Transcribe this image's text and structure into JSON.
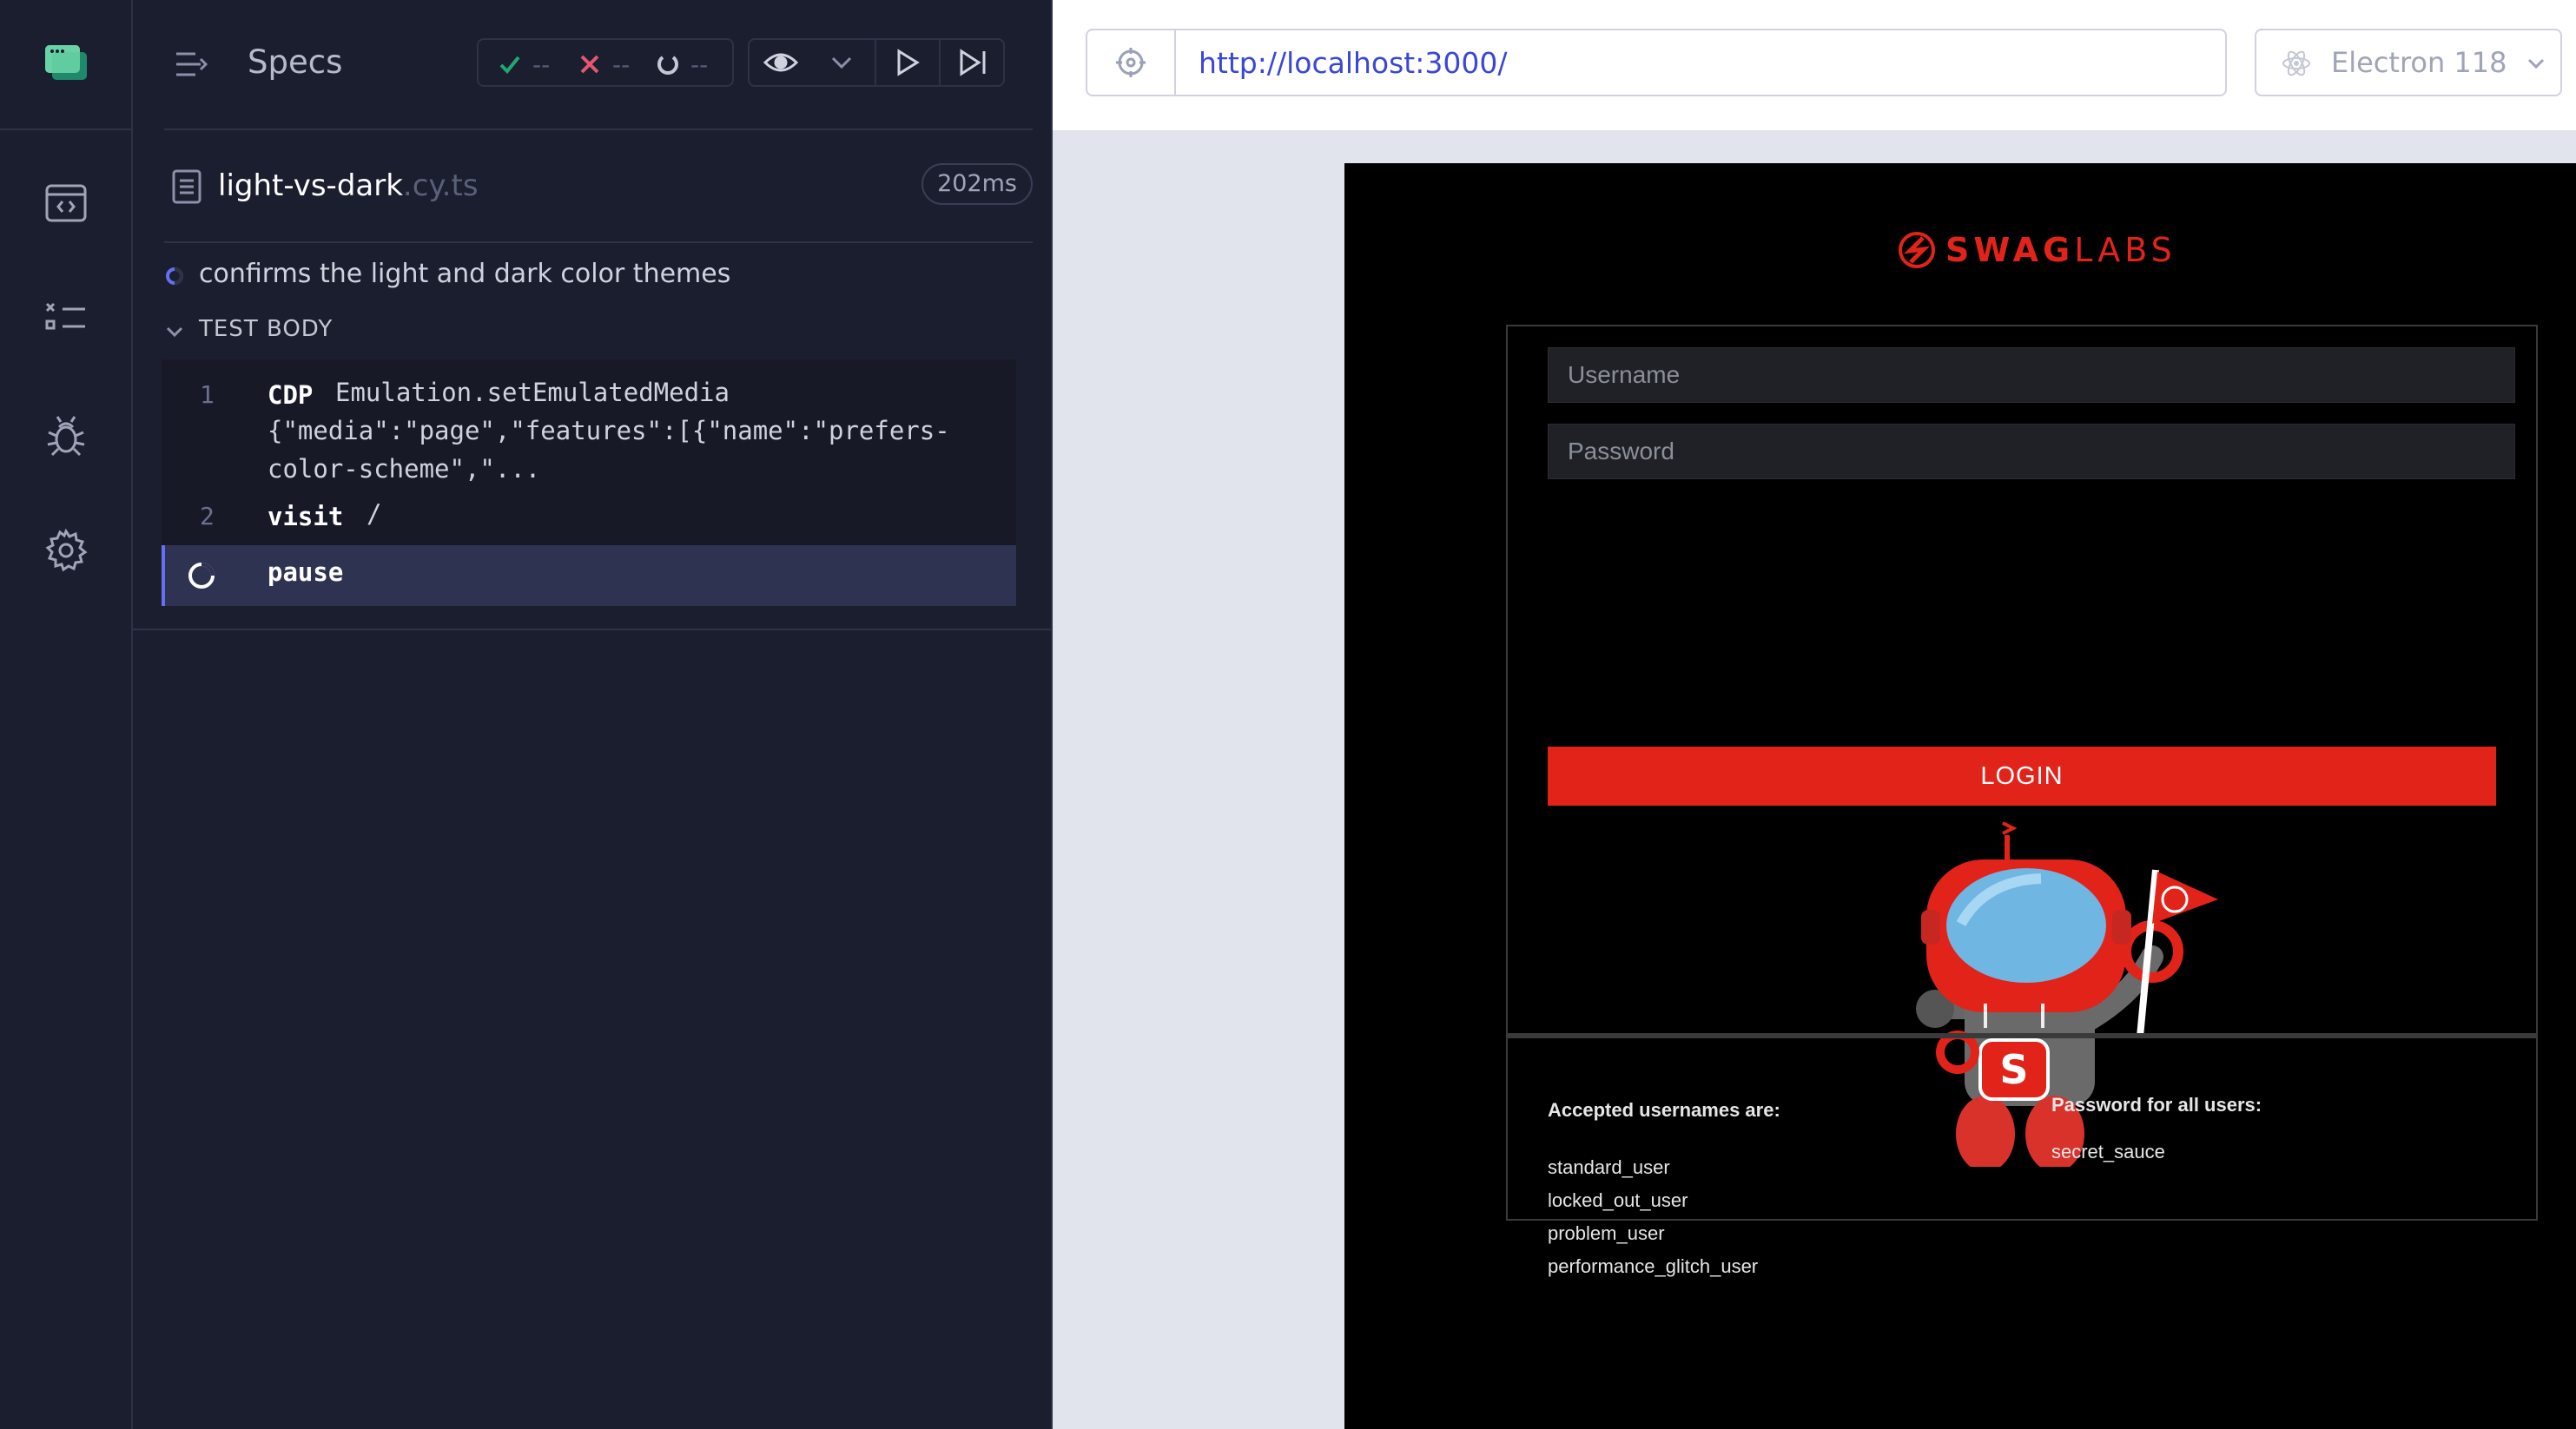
{
  "sidebar": {
    "items": [
      {
        "name": "specs-nav"
      },
      {
        "name": "runs-nav"
      },
      {
        "name": "debug-nav"
      },
      {
        "name": "settings-nav"
      }
    ]
  },
  "reporter": {
    "header_title": "Specs",
    "stats": {
      "passed": "--",
      "failed": "--",
      "pending": "--"
    },
    "spec_file": {
      "name": "light-vs-dark",
      "ext": ".cy.ts",
      "duration": "202ms"
    },
    "test_title": "confirms the light and dark color themes",
    "test_body_label": "TEST BODY",
    "commands": [
      {
        "num": "1",
        "name": "CDP",
        "message": "Emulation.setEmulatedMedia",
        "message_cont_1": "{\"media\":\"page\",\"features\":[{\"name\":\"prefers-",
        "message_cont_2": "color-scheme\",\"..."
      },
      {
        "num": "2",
        "name": "visit",
        "message": "/"
      },
      {
        "num": "",
        "name": "pause",
        "message": ""
      }
    ]
  },
  "aut": {
    "url": "http://localhost:3000/",
    "browser": "Electron 118",
    "page": {
      "brand_bold": "SWAG",
      "brand_light": "LABS",
      "username_placeholder": "Username",
      "password_placeholder": "Password",
      "login_label": "LOGIN",
      "accepted_heading": "Accepted usernames are:",
      "usernames": [
        "standard_user",
        "locked_out_user",
        "problem_user",
        "performance_glitch_user"
      ],
      "password_heading": "Password for all users:",
      "password_value": "secret_sauce"
    }
  },
  "colors": {
    "reporter_bg": "#1b1e2e",
    "accent": "#6470f3",
    "swag_red": "#e2231a",
    "url_blue": "#3a47d6"
  }
}
